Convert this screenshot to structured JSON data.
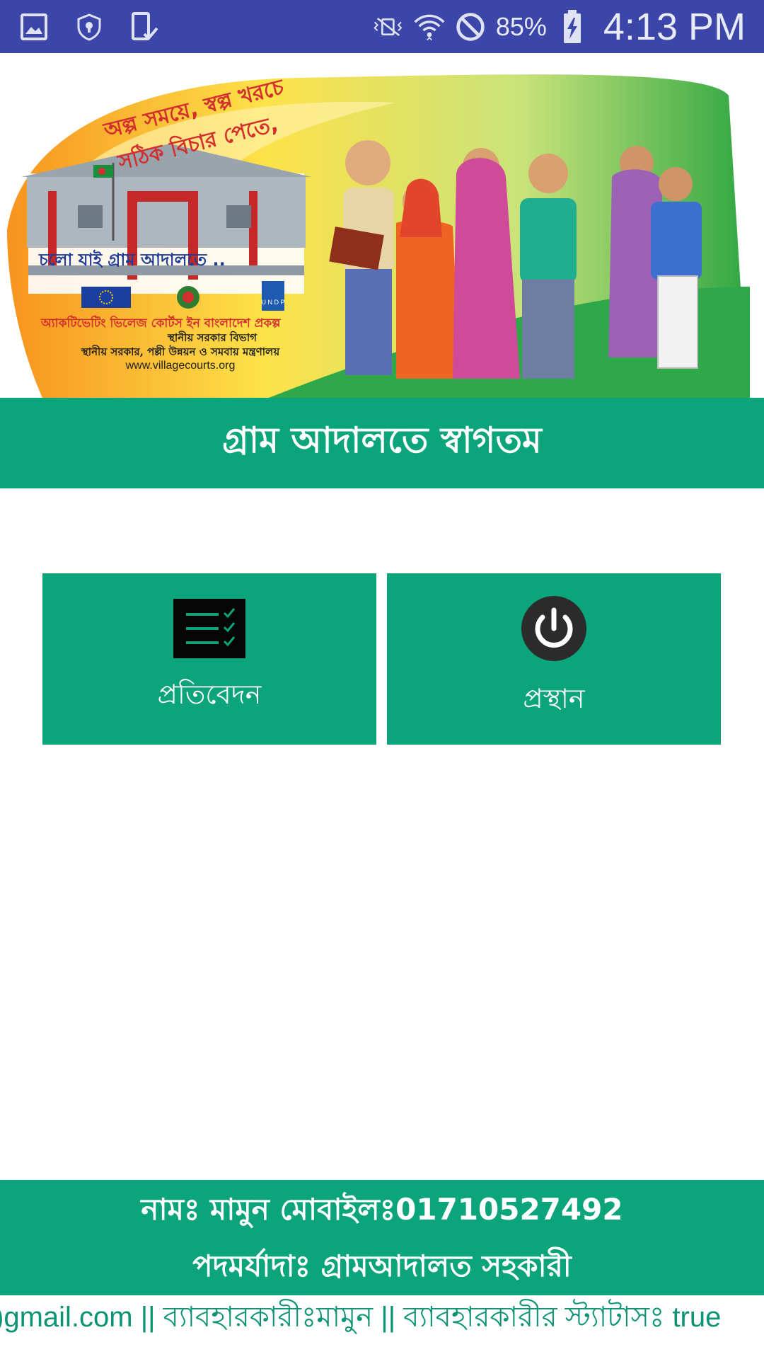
{
  "status_bar": {
    "battery_percent": "85%",
    "time": "4:13 PM",
    "icons_left": [
      "image-icon",
      "shield-icon",
      "phone-check-icon"
    ],
    "icons_right": [
      "vibrate-off-icon",
      "wifi-icon",
      "do-not-disturb-icon",
      "battery-charging-icon"
    ]
  },
  "banner": {
    "slogan_line1": "অল্প সময়ে, স্বল্প খরচে",
    "slogan_line2": "সঠিক বিচার পেতে,",
    "call_to_action": "চলো যাই গ্রাম আদালতে ..",
    "project_name": "অ্যাকটিভেটিং ভিলেজ কোর্টস ইন বাংলাদেশ প্রকল্প",
    "department": "স্থানীয় সরকার বিভাগ",
    "ministry": "স্থানীয় সরকার, পল্লী উন্নয়ন ও সমবায় মন্ত্রণালয়",
    "website": "www.villagecourts.org",
    "undp_logo_text": "U N D P"
  },
  "header": {
    "title": "গ্রাম আদালতে স্বাগতম"
  },
  "tiles": {
    "report_label": "প্রতিবেদন",
    "exit_label": "প্রস্থান"
  },
  "footer": {
    "name_line": "নামঃ মামুন মোবাইলঃ01710527492",
    "designation_line": "পদমর্যাদাঃ গ্রামআদালত সহকারী"
  },
  "ticker": {
    "text": ")gmail.com || ব্যাবহারকারীঃমামুন || ব্যাবহারকারীর স্ট্যাটাসঃ true"
  },
  "colors": {
    "status_bar": "#3b46a8",
    "primary_green": "#0ba47b",
    "ticker_text": "#0b9473"
  }
}
